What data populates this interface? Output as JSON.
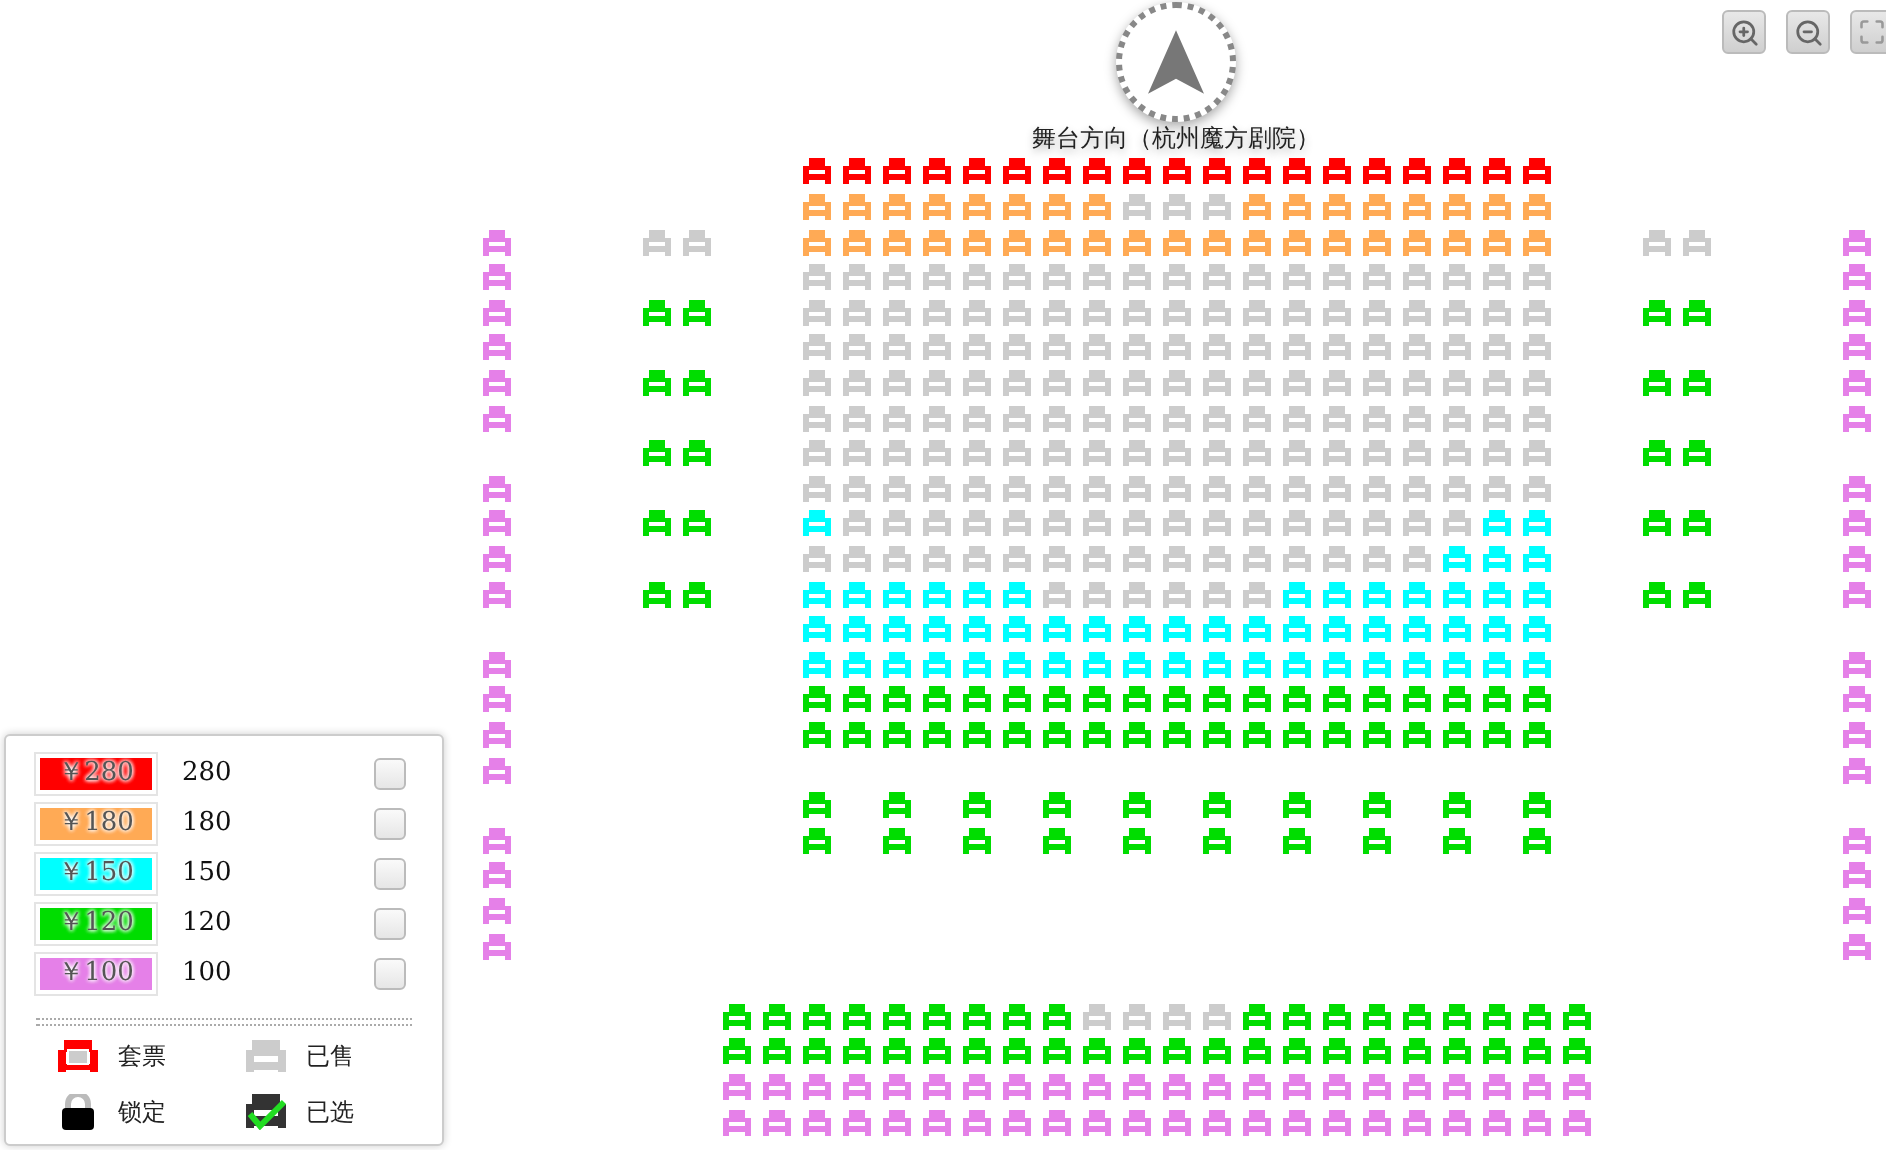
{
  "stage": {
    "title": "舞台方向（杭州魔方剧院）"
  },
  "seat_map": {
    "main_rows": [
      {
        "color": "#ff0000",
        "sold": [
          false,
          false,
          false,
          false,
          false,
          false,
          false,
          false,
          false,
          false,
          false,
          false,
          false,
          false,
          false,
          false,
          false,
          false,
          false
        ]
      },
      {
        "color": "#ffaa55",
        "sold": [
          false,
          false,
          false,
          false,
          false,
          false,
          false,
          false,
          true,
          true,
          true,
          false,
          false,
          false,
          false,
          false,
          false,
          false,
          false
        ]
      },
      {
        "color": "#ffaa55",
        "sold": [
          false,
          false,
          false,
          false,
          false,
          false,
          false,
          false,
          false,
          false,
          false,
          false,
          false,
          false,
          false,
          false,
          false,
          false,
          false
        ]
      },
      {
        "sold": [
          true,
          true,
          true,
          true,
          true,
          true,
          true,
          true,
          true,
          true,
          true,
          true,
          true,
          true,
          true,
          true,
          true,
          true,
          true
        ]
      },
      {
        "sold": [
          true,
          true,
          true,
          true,
          true,
          true,
          true,
          true,
          true,
          true,
          true,
          true,
          true,
          true,
          true,
          true,
          true,
          true,
          true
        ]
      },
      {
        "sold": [
          true,
          true,
          true,
          true,
          true,
          true,
          true,
          true,
          true,
          true,
          true,
          true,
          true,
          true,
          true,
          true,
          true,
          true,
          true
        ]
      },
      {
        "sold": [
          true,
          true,
          true,
          true,
          true,
          true,
          true,
          true,
          true,
          true,
          true,
          true,
          true,
          true,
          true,
          true,
          true,
          true,
          true
        ]
      },
      {
        "sold": [
          true,
          true,
          true,
          true,
          true,
          true,
          true,
          true,
          true,
          true,
          true,
          true,
          true,
          true,
          true,
          true,
          true,
          true,
          true
        ]
      },
      {
        "sold": [
          true,
          true,
          true,
          true,
          true,
          true,
          true,
          true,
          true,
          true,
          true,
          true,
          true,
          true,
          true,
          true,
          true,
          true,
          true
        ]
      },
      {
        "sold": [
          true,
          true,
          true,
          true,
          true,
          true,
          true,
          true,
          true,
          true,
          true,
          true,
          true,
          true,
          true,
          true,
          true,
          true,
          true
        ]
      },
      {
        "color": "#00ffff",
        "sold": [
          false,
          true,
          true,
          true,
          true,
          true,
          true,
          true,
          true,
          true,
          true,
          true,
          true,
          true,
          true,
          true,
          true,
          false,
          false
        ]
      },
      {
        "color": "#00ffff",
        "sold": [
          true,
          true,
          true,
          true,
          true,
          true,
          true,
          true,
          true,
          true,
          true,
          true,
          true,
          true,
          true,
          true,
          false,
          false,
          false
        ]
      },
      {
        "color": "#00ffff",
        "sold": [
          false,
          false,
          false,
          false,
          false,
          false,
          true,
          true,
          true,
          true,
          true,
          true,
          false,
          false,
          false,
          false,
          false,
          false,
          false
        ]
      },
      {
        "color": "#00ffff",
        "sold": [
          false,
          false,
          false,
          false,
          false,
          false,
          false,
          false,
          false,
          false,
          false,
          false,
          false,
          false,
          false,
          false,
          false,
          false,
          false
        ]
      },
      {
        "color": "#00ffff",
        "sold": [
          false,
          false,
          false,
          false,
          false,
          false,
          false,
          false,
          false,
          false,
          false,
          false,
          false,
          false,
          false,
          false,
          false,
          false,
          false
        ]
      },
      {
        "color": "#00dd00",
        "sold": [
          false,
          false,
          false,
          false,
          false,
          false,
          false,
          false,
          false,
          false,
          false,
          false,
          false,
          false,
          false,
          false,
          false,
          false,
          false
        ]
      },
      {
        "color": "#00dd00",
        "sold": [
          false,
          false,
          false,
          false,
          false,
          false,
          false,
          false,
          false,
          false,
          false,
          false,
          false,
          false,
          false,
          false,
          false,
          false,
          false
        ]
      }
    ],
    "spaced_rows": [
      {
        "color": "#00dd00",
        "sold": [
          false,
          false,
          false,
          false,
          false,
          false,
          false,
          false,
          false,
          false
        ]
      },
      {
        "color": "#00dd00",
        "sold": [
          false,
          false,
          false,
          false,
          false,
          false,
          false,
          false,
          false,
          false
        ]
      }
    ],
    "left_boxes": [
      {
        "sold": [
          true,
          true
        ]
      },
      {
        "color": "#00dd00",
        "sold": [
          false,
          false
        ]
      },
      {
        "color": "#00dd00",
        "sold": [
          false,
          false
        ]
      },
      {
        "color": "#00dd00",
        "sold": [
          false,
          false
        ]
      },
      {
        "color": "#00dd00",
        "sold": [
          false,
          false
        ]
      },
      {
        "color": "#00dd00",
        "sold": [
          false,
          false
        ]
      }
    ],
    "right_boxes": [
      {
        "sold": [
          true,
          true
        ]
      },
      {
        "color": "#00dd00",
        "sold": [
          false,
          false
        ]
      },
      {
        "color": "#00dd00",
        "sold": [
          false,
          false
        ]
      },
      {
        "color": "#00dd00",
        "sold": [
          false,
          false
        ]
      },
      {
        "color": "#00dd00",
        "sold": [
          false,
          false
        ]
      },
      {
        "color": "#00dd00",
        "sold": [
          false,
          false
        ]
      }
    ],
    "left_aisle_groups": [
      {
        "color": "#e580e8",
        "sold": [
          false,
          false,
          false,
          false,
          false,
          false
        ]
      },
      {
        "color": "#e580e8",
        "sold": [
          false,
          false,
          false,
          false
        ]
      },
      {
        "color": "#e580e8",
        "sold": [
          false,
          false,
          false,
          false
        ]
      },
      {
        "color": "#e580e8",
        "sold": [
          false,
          false,
          false,
          false
        ]
      }
    ],
    "right_aisle_groups": [
      {
        "color": "#e580e8",
        "sold": [
          false,
          false,
          false,
          false,
          false,
          false
        ]
      },
      {
        "color": "#e580e8",
        "sold": [
          false,
          false,
          false,
          false
        ]
      },
      {
        "color": "#e580e8",
        "sold": [
          false,
          false,
          false,
          false
        ]
      },
      {
        "color": "#e580e8",
        "sold": [
          false,
          false,
          false,
          false
        ]
      }
    ],
    "balcony_rows": [
      {
        "color": "#00dd00",
        "sold": [
          false,
          false,
          false,
          false,
          false,
          false,
          false,
          false,
          false,
          true,
          true,
          true,
          true,
          false,
          false,
          false,
          false,
          false,
          false,
          false,
          false,
          false
        ]
      },
      {
        "color": "#00dd00",
        "sold": [
          false,
          false,
          false,
          false,
          false,
          false,
          false,
          false,
          false,
          false,
          false,
          false,
          false,
          false,
          false,
          false,
          false,
          false,
          false,
          false,
          false,
          false
        ]
      },
      {
        "color": "#e580e8",
        "sold": [
          false,
          false,
          false,
          false,
          false,
          false,
          false,
          false,
          false,
          false,
          false,
          false,
          false,
          false,
          false,
          false,
          false,
          false,
          false,
          false,
          false,
          false
        ]
      },
      {
        "color": "#e580e8",
        "sold": [
          false,
          false,
          false,
          false,
          false,
          false,
          false,
          false,
          false,
          false,
          false,
          false,
          false,
          false,
          false,
          false,
          false,
          false,
          false,
          false,
          false,
          false
        ]
      }
    ]
  },
  "legend": {
    "price_tiers": [
      {
        "label": "￥280",
        "value": "280",
        "color": "#ff0000",
        "checked": false
      },
      {
        "label": "￥180",
        "value": "180",
        "color": "#ffaa55",
        "checked": false
      },
      {
        "label": "￥150",
        "value": "150",
        "color": "#00ffff",
        "checked": false
      },
      {
        "label": "￥120",
        "value": "120",
        "color": "#00dd00",
        "checked": false
      },
      {
        "label": "￥100",
        "value": "100",
        "color": "#e580e8",
        "checked": false
      }
    ],
    "seat_types": [
      {
        "kind": "package",
        "label": "套票"
      },
      {
        "kind": "sold",
        "label": "已售"
      },
      {
        "kind": "locked",
        "label": "锁定"
      },
      {
        "kind": "selected",
        "label": "已选"
      }
    ]
  }
}
